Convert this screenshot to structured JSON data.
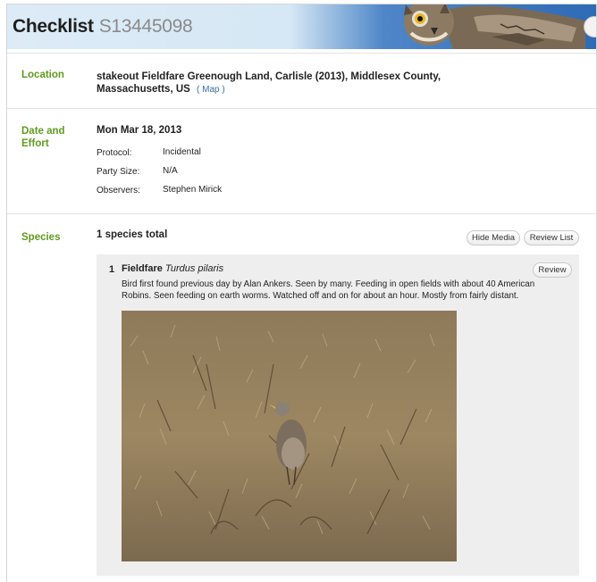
{
  "header": {
    "title": "Checklist",
    "checklist_id": "S13445098"
  },
  "location": {
    "label": "Location",
    "text": "stakeout Fieldfare Greenough Land, Carlisle (2013), Middlesex County, Massachusetts, US",
    "map_link": "( Map )"
  },
  "date_effort": {
    "label": "Date and Effort",
    "date": "Mon Mar 18, 2013",
    "rows": [
      {
        "label": "Protocol:",
        "value": "Incidental"
      },
      {
        "label": "Party Size:",
        "value": "N/A"
      },
      {
        "label": "Observers:",
        "value": "Stephen Mirick"
      }
    ]
  },
  "species": {
    "label": "Species",
    "total": "1 species total",
    "hide_media": "Hide Media",
    "review_list": "Review List",
    "items": [
      {
        "number": "1",
        "common_name": "Fieldfare",
        "scientific_name": "Turdus pilaris",
        "review": "Review",
        "comment": "Bird first found previous day by Alan Ankers. Seen by many. Feeding in open fields with about 40 American Robins. Seen feeding on earth worms. Watched off and on for about an hour. Mostly from fairly distant."
      }
    ]
  },
  "colors": {
    "label_green": "#5f9a21",
    "header_blue": "#2e6bb6",
    "link_blue": "#3a6ea5"
  }
}
